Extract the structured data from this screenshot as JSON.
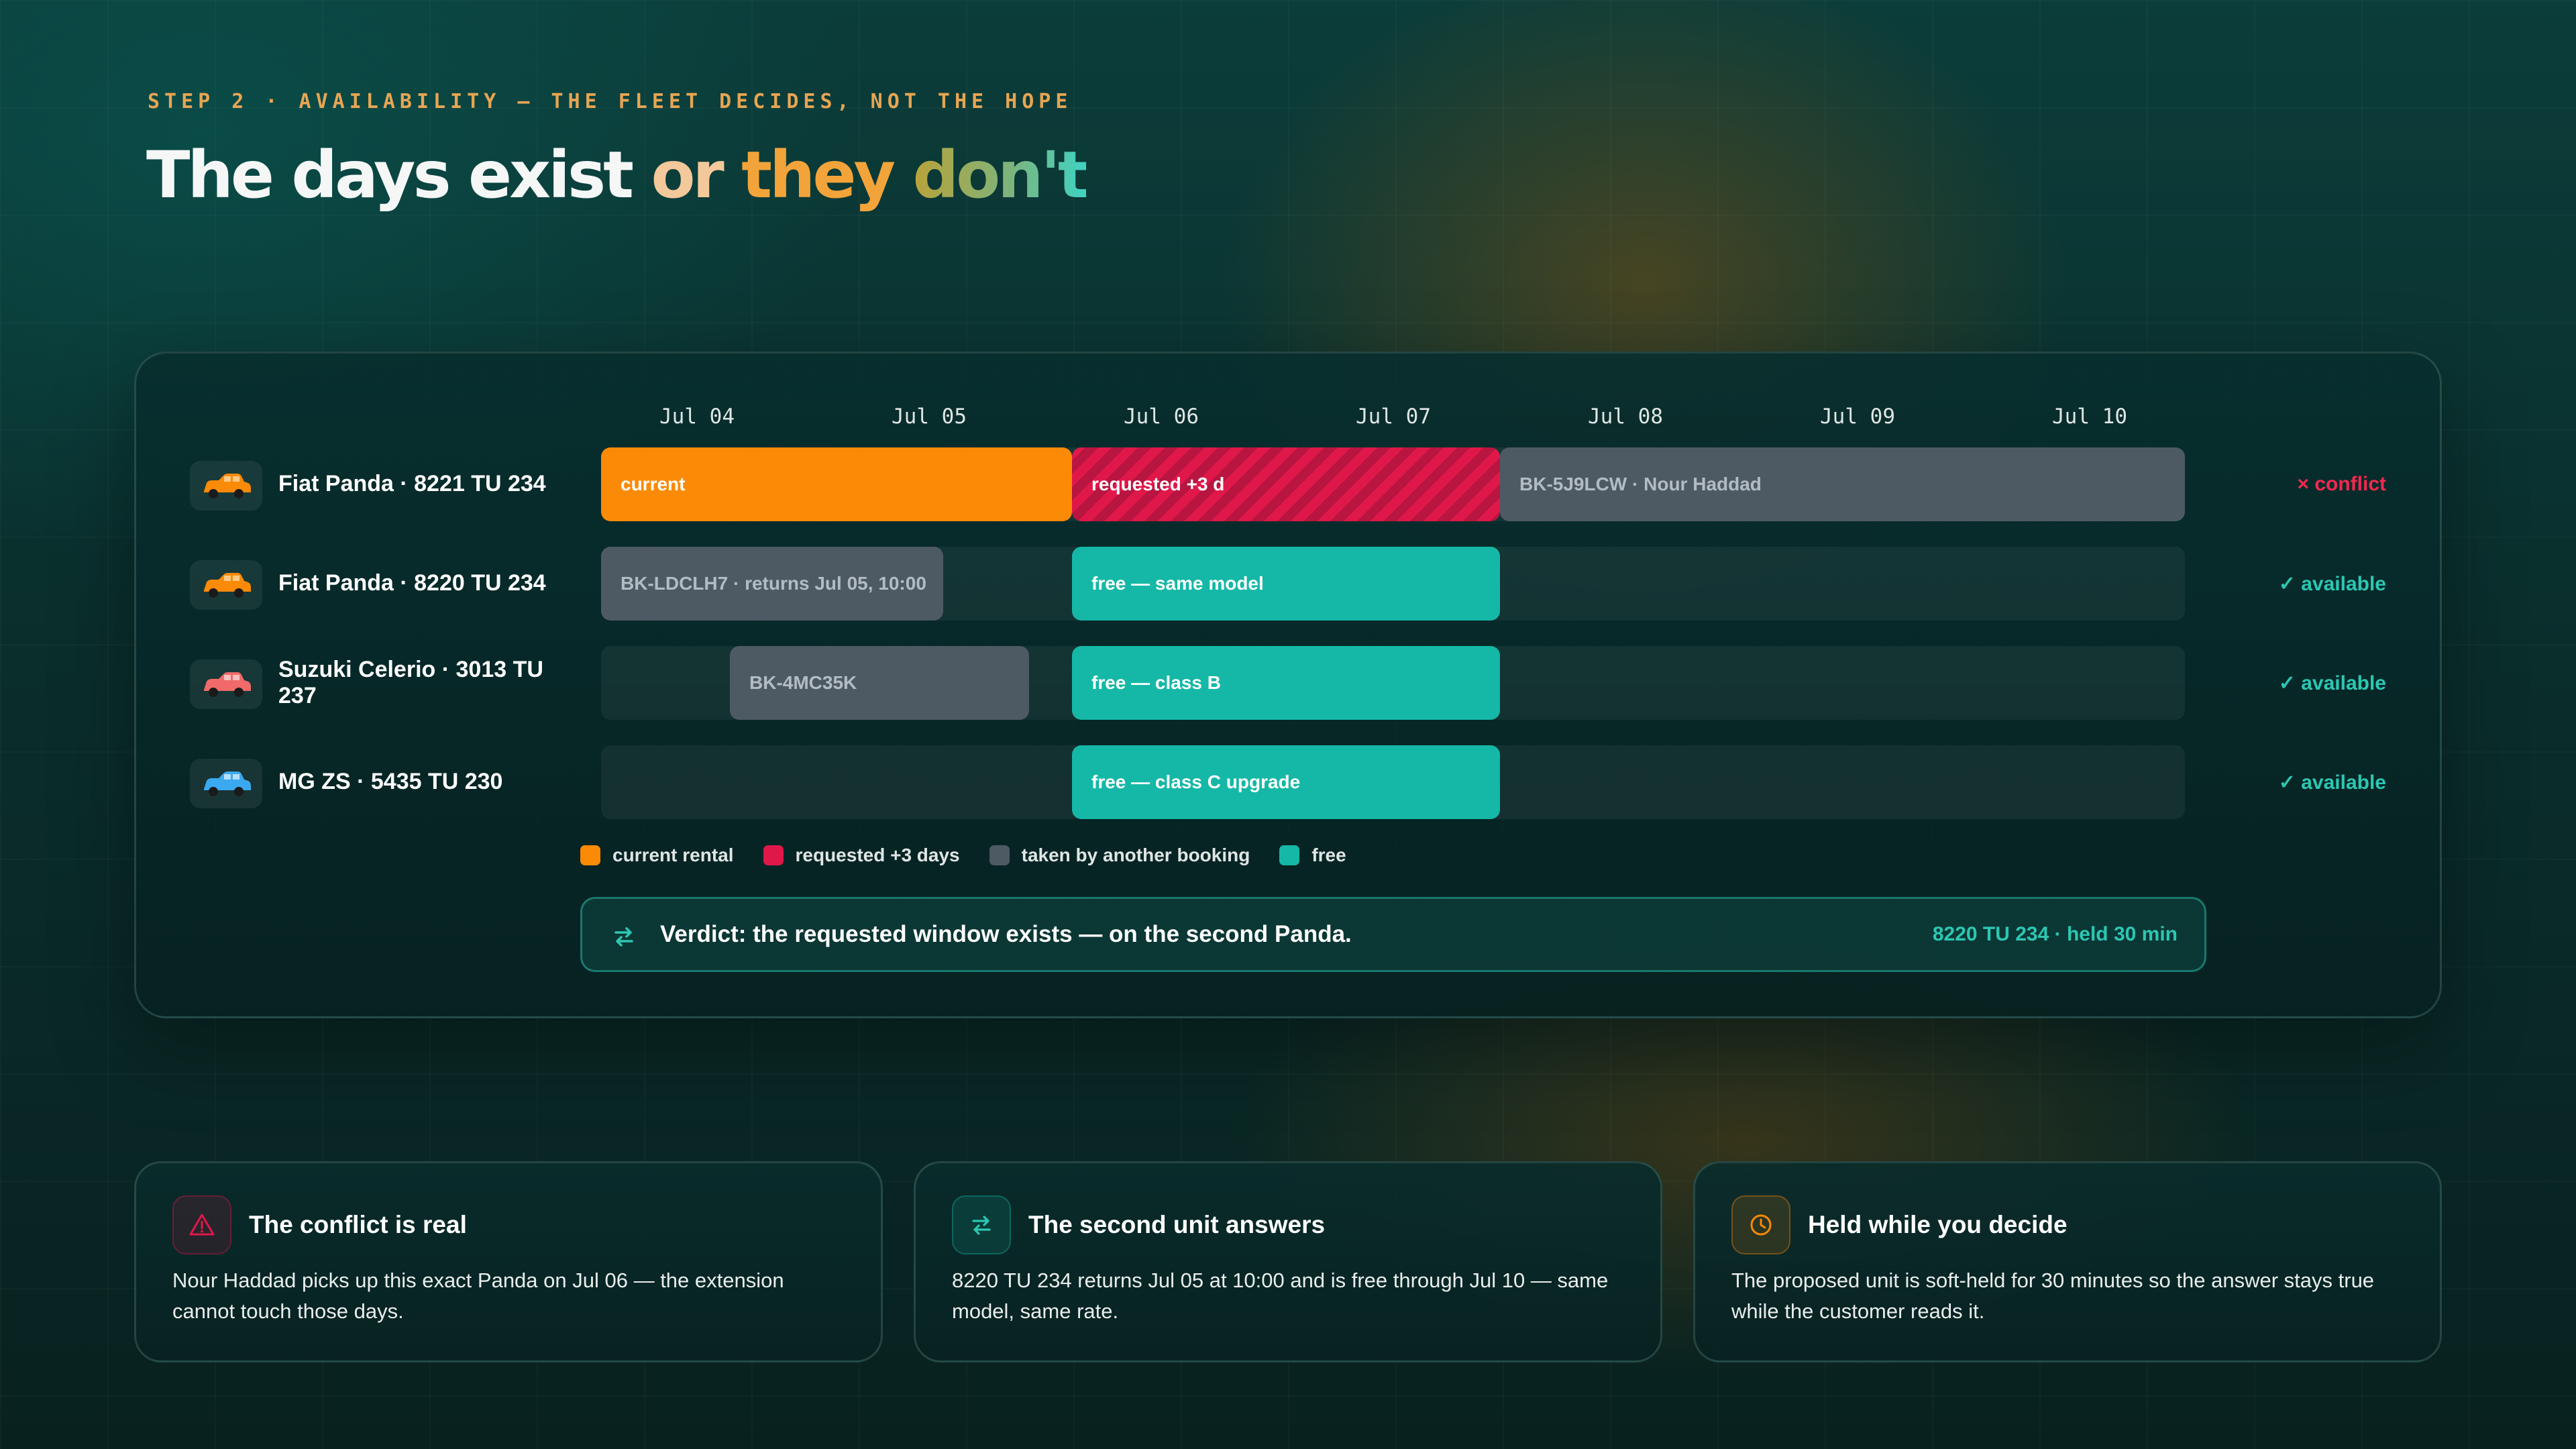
{
  "header": {
    "eyebrow": "STEP 2 · AVAILABILITY — THE FLEET DECIDES, NOT THE HOPE",
    "title_part1": "The days exist ",
    "title_or": "or ",
    "title_they": "they ",
    "title_dont": "don't"
  },
  "timeline": {
    "dates": [
      "Jul 04",
      "Jul 05",
      "Jul 06",
      "Jul 07",
      "Jul 08",
      "Jul 09",
      "Jul 10"
    ],
    "rows": [
      {
        "vehicle": "Fiat Panda · 8221 TU 234",
        "icon": "car-icon",
        "icon_color": "#fb8a06",
        "segments": [
          {
            "type": "current",
            "label": "current"
          },
          {
            "type": "requested",
            "label": "requested +3 d"
          },
          {
            "type": "taken",
            "label": "BK-5J9LCW · Nour Haddad"
          }
        ],
        "status": "× conflict",
        "status_type": "conflict"
      },
      {
        "vehicle": "Fiat Panda · 8220 TU 234",
        "icon": "car-icon",
        "icon_color": "#fb8a06",
        "segments": [
          {
            "type": "taken",
            "label": "BK-LDCLH7 · returns Jul 05, 10:00"
          },
          {
            "type": "free",
            "label": "free — same model"
          }
        ],
        "status": "✓ available",
        "status_type": "ok"
      },
      {
        "vehicle": "Suzuki Celerio · 3013 TU 237",
        "icon": "car-icon",
        "icon_color": "#f06a6a",
        "segments": [
          {
            "type": "taken",
            "label": "BK-4MC35K"
          },
          {
            "type": "free",
            "label": "free — class B"
          }
        ],
        "status": "✓ available",
        "status_type": "ok"
      },
      {
        "vehicle": "MG ZS · 5435 TU 230",
        "icon": "car-icon",
        "icon_color": "#3ba9f0",
        "segments": [
          {
            "type": "free",
            "label": "free — class C upgrade"
          }
        ],
        "status": "✓ available",
        "status_type": "ok"
      }
    ],
    "legend": [
      {
        "label": "current rental",
        "color": "#fb8a06"
      },
      {
        "label": "requested +3 days",
        "color": "#e0184a"
      },
      {
        "label": "taken by another booking",
        "color": "#4d5a64"
      },
      {
        "label": "free",
        "color": "#15b8a6"
      }
    ],
    "verdict": {
      "text": "Verdict: the requested window exists — on the second Panda.",
      "hold": "8220 TU 234 · held 30 min"
    }
  },
  "cards": [
    {
      "icon": "warning-triangle-icon",
      "title": "The conflict is real",
      "body": "Nour Haddad picks up this exact Panda on Jul 06 — the extension cannot touch those days."
    },
    {
      "icon": "swap-arrows-icon",
      "title": "The second unit answers",
      "body": "8220 TU 234 returns Jul 05 at 10:00 and is free through Jul 10 — same model, same rate."
    },
    {
      "icon": "clock-icon",
      "title": "Held while you decide",
      "body": "The proposed unit is soft-held for 30 minutes so the answer stays true while the customer reads it."
    }
  ],
  "colors": {
    "current": "#fb8a06",
    "requested": "#e0184a",
    "taken": "#4d5a64",
    "free": "#15b8a6",
    "accent": "#2cc7b3",
    "conflict": "#f0294f"
  }
}
